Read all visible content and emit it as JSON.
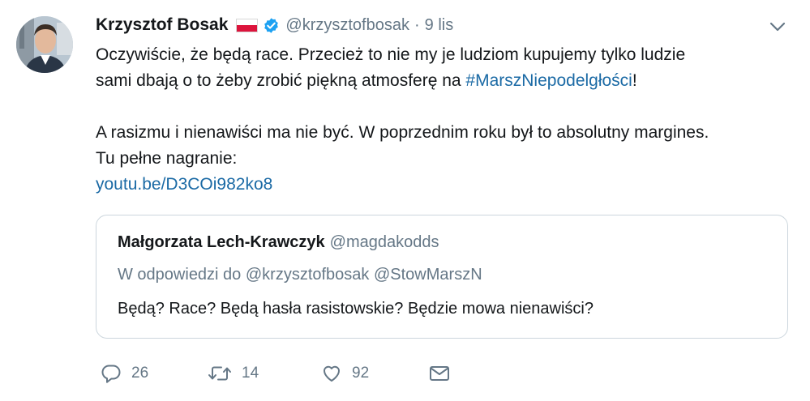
{
  "tweet": {
    "author_name": "Krzysztof Bosak",
    "author_handle": "@krzysztofbosak",
    "separator": "·",
    "timestamp": "9 lis",
    "text_line1": "Oczywiście, że będą race. Przecież to nie my je ludziom kupujemy tylko ludzie",
    "text_line2_prefix": "sami dbają o to żeby zrobić piękną atmosferę na ",
    "hashtag": "#MarszNiepodelgłości",
    "text_line2_suffix": "!",
    "text_line3": "A rasizmu i nienawiści ma nie być. W poprzednim roku był to absolutny margines.",
    "text_line4": "Tu pełne nagranie:",
    "link": "youtu.be/D3COi982ko8",
    "flag_colors": [
      "#ffffff",
      "#dc143c"
    ],
    "verified_color": "#1da1f2",
    "link_color": "#1b6aa5"
  },
  "quoted": {
    "author_name": "Małgorzata Lech-Krawczyk",
    "author_handle": "@magdakodds",
    "reply_context": "W odpowiedzi do @krzysztofbosak @StowMarszN",
    "text": "Będą? Race? Będą hasła rasistowskie? Będzie mowa nienawiści?"
  },
  "actions": {
    "reply": {
      "icon": "reply-icon",
      "count": "26"
    },
    "retweet": {
      "icon": "retweet-icon",
      "count": "14"
    },
    "like": {
      "icon": "heart-icon",
      "count": "92"
    },
    "message": {
      "icon": "envelope-icon"
    }
  }
}
